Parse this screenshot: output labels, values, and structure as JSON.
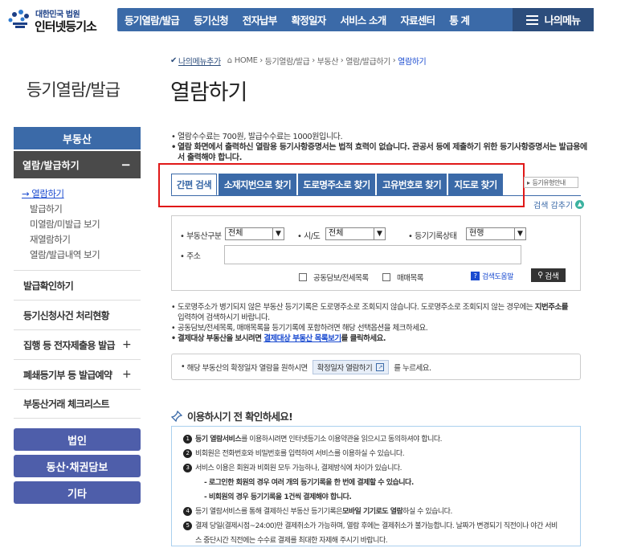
{
  "header": {
    "logo_small": "대한민국 법원",
    "logo_big": "인터넷등기소",
    "nav": [
      "등기열람/발급",
      "등기신청",
      "전자납부",
      "확정일자",
      "서비스 소개",
      "자료센터",
      "통 계"
    ],
    "my_menu": "나의메뉴"
  },
  "sidebar": {
    "title": "등기열람/발급",
    "category": "부동산",
    "open_section": "열람/발급하기",
    "open_toggle": "−",
    "sub_items": [
      "열람하기",
      "발급하기",
      "미열람/미발급 보기",
      "재열람하기",
      "열람/발급내역 보기"
    ],
    "items": [
      {
        "label": "발급확인하기",
        "toggle": ""
      },
      {
        "label": "등기신청사건 처리현황",
        "toggle": ""
      },
      {
        "label": "집행 등 전자제출용 발급",
        "toggle": "+"
      },
      {
        "label": "폐쇄등기부 등 발급예약",
        "toggle": "+"
      },
      {
        "label": "부동산거래 체크리스트",
        "toggle": ""
      }
    ],
    "buttons": [
      "법인",
      "동산·채권담보",
      "기타"
    ]
  },
  "breadcrumb": {
    "favorite": "나의메뉴추가",
    "items": [
      "HOME",
      "등기열람/발급",
      "부동산",
      "열람/발급하기"
    ],
    "current": "열람하기"
  },
  "page_title": "열람하기",
  "notice": {
    "line1": "열람수수료는 700원, 발급수수료는 1000원입니다.",
    "line2": "열람 화면에서 출력하신 열람용 등기사항증명서는 법적 효력이 없습니다. 관공서 등에 제출하기 위한 등기사항증명서는 발급용에서 출력해야 합니다."
  },
  "tabs": [
    "간편 검색",
    "소재지번으로 찾기",
    "도로명주소로 찾기",
    "고유번호로 찾기",
    "지도로 찾기"
  ],
  "guide_label": "등기유형안내",
  "collapse_label": "검색 감추기",
  "search": {
    "type_label": "부동산구분",
    "type_value": "전체",
    "sido_label": "시/도",
    "sido_value": "전체",
    "status_label": "등기기록상태",
    "status_value": "현행",
    "addr_label": "주소",
    "addr_value": "",
    "chk1": "공동담보/전세목록",
    "chk2": "매매목록",
    "help": "검색도움말",
    "button": "검색"
  },
  "notes": {
    "n1a": "도로명주소가 병기되지 않은 부동산 등기기록은 도로명주소로 조회되지 않습니다. 도로명주소로 조회되지 않는 경우에는 ",
    "n1b": "지번주소를",
    "n1c": "입력하여 검색하시기 바랍니다.",
    "n2": "공동담보/전세목록, 매매목록을 등기기록에 포함하려면 해당 선택옵션을 체크하세요.",
    "n3a": "결제대상 부동산을 보시려면 ",
    "n3b": "결제대상 부동산 목록보기",
    "n3c": "를 클릭하세요."
  },
  "box2": {
    "before": "해당 부동산의 확정일자 열람을 원하시면",
    "button": "확정일자 열람하기",
    "after": "를 누르세요."
  },
  "check": {
    "title": "이용하시기 전 확인하세요!",
    "rows": [
      {
        "num": "1",
        "bold": "등기 열람서비스",
        "text": "를 이용하시려면 인터넷등기소 이용약관을 읽으시고 동의하셔야 합니다."
      },
      {
        "num": "2",
        "bold": "",
        "text": "비회원은 전화번호와 비밀번호를 입력하여 서비스를 이용하실 수 있습니다."
      },
      {
        "num": "3",
        "bold": "",
        "text": "서비스 이용은 회원과 비회원 모두 가능하나, 결제방식에 차이가 있습니다."
      },
      {
        "num": "",
        "bold": "- 로그인한 회원의 경우 여러 개의 등기기록을 한 번에 결제할 수 있습니다.",
        "text": ""
      },
      {
        "num": "",
        "bold": "- 비회원의 경우 등기기록을 1건씩 결제해야 합니다.",
        "text": ""
      },
      {
        "num": "4",
        "bold": "",
        "text": "등기 열람서비스를 통해 결제하신 부동산 등기기록은 ",
        "bold2": "모바일 기기로도 열람",
        "text2": "하실 수 있습니다."
      },
      {
        "num": "5",
        "bold": "",
        "text": "결제 당일(결제시점~24:00)만 결제취소가 가능하며, 열람 후에는 결제취소가 불가능합니다. 날짜가 변경되기 직전이나 야간 서비"
      },
      {
        "num": "",
        "bold": "",
        "text": "스 중단시간 직전에는 수수료 결제를 최대한 자제해 주시기 바랍니다."
      }
    ]
  }
}
